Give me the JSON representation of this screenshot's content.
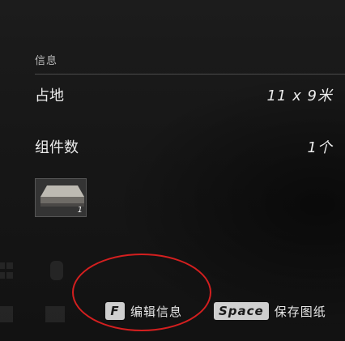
{
  "info_panel": {
    "title": "信息",
    "area_label": "占地",
    "area_value": "11 x 9米",
    "parts_label": "组件数",
    "parts_value": "1个",
    "thumbnail_count": "1"
  },
  "footer": {
    "edit_key": "F",
    "edit_label": "编辑信息",
    "save_key": "Space",
    "save_label": "保存图纸"
  },
  "colors": {
    "annotation_circle": "#d41f1f",
    "key_cap": "#cfcfcf"
  }
}
